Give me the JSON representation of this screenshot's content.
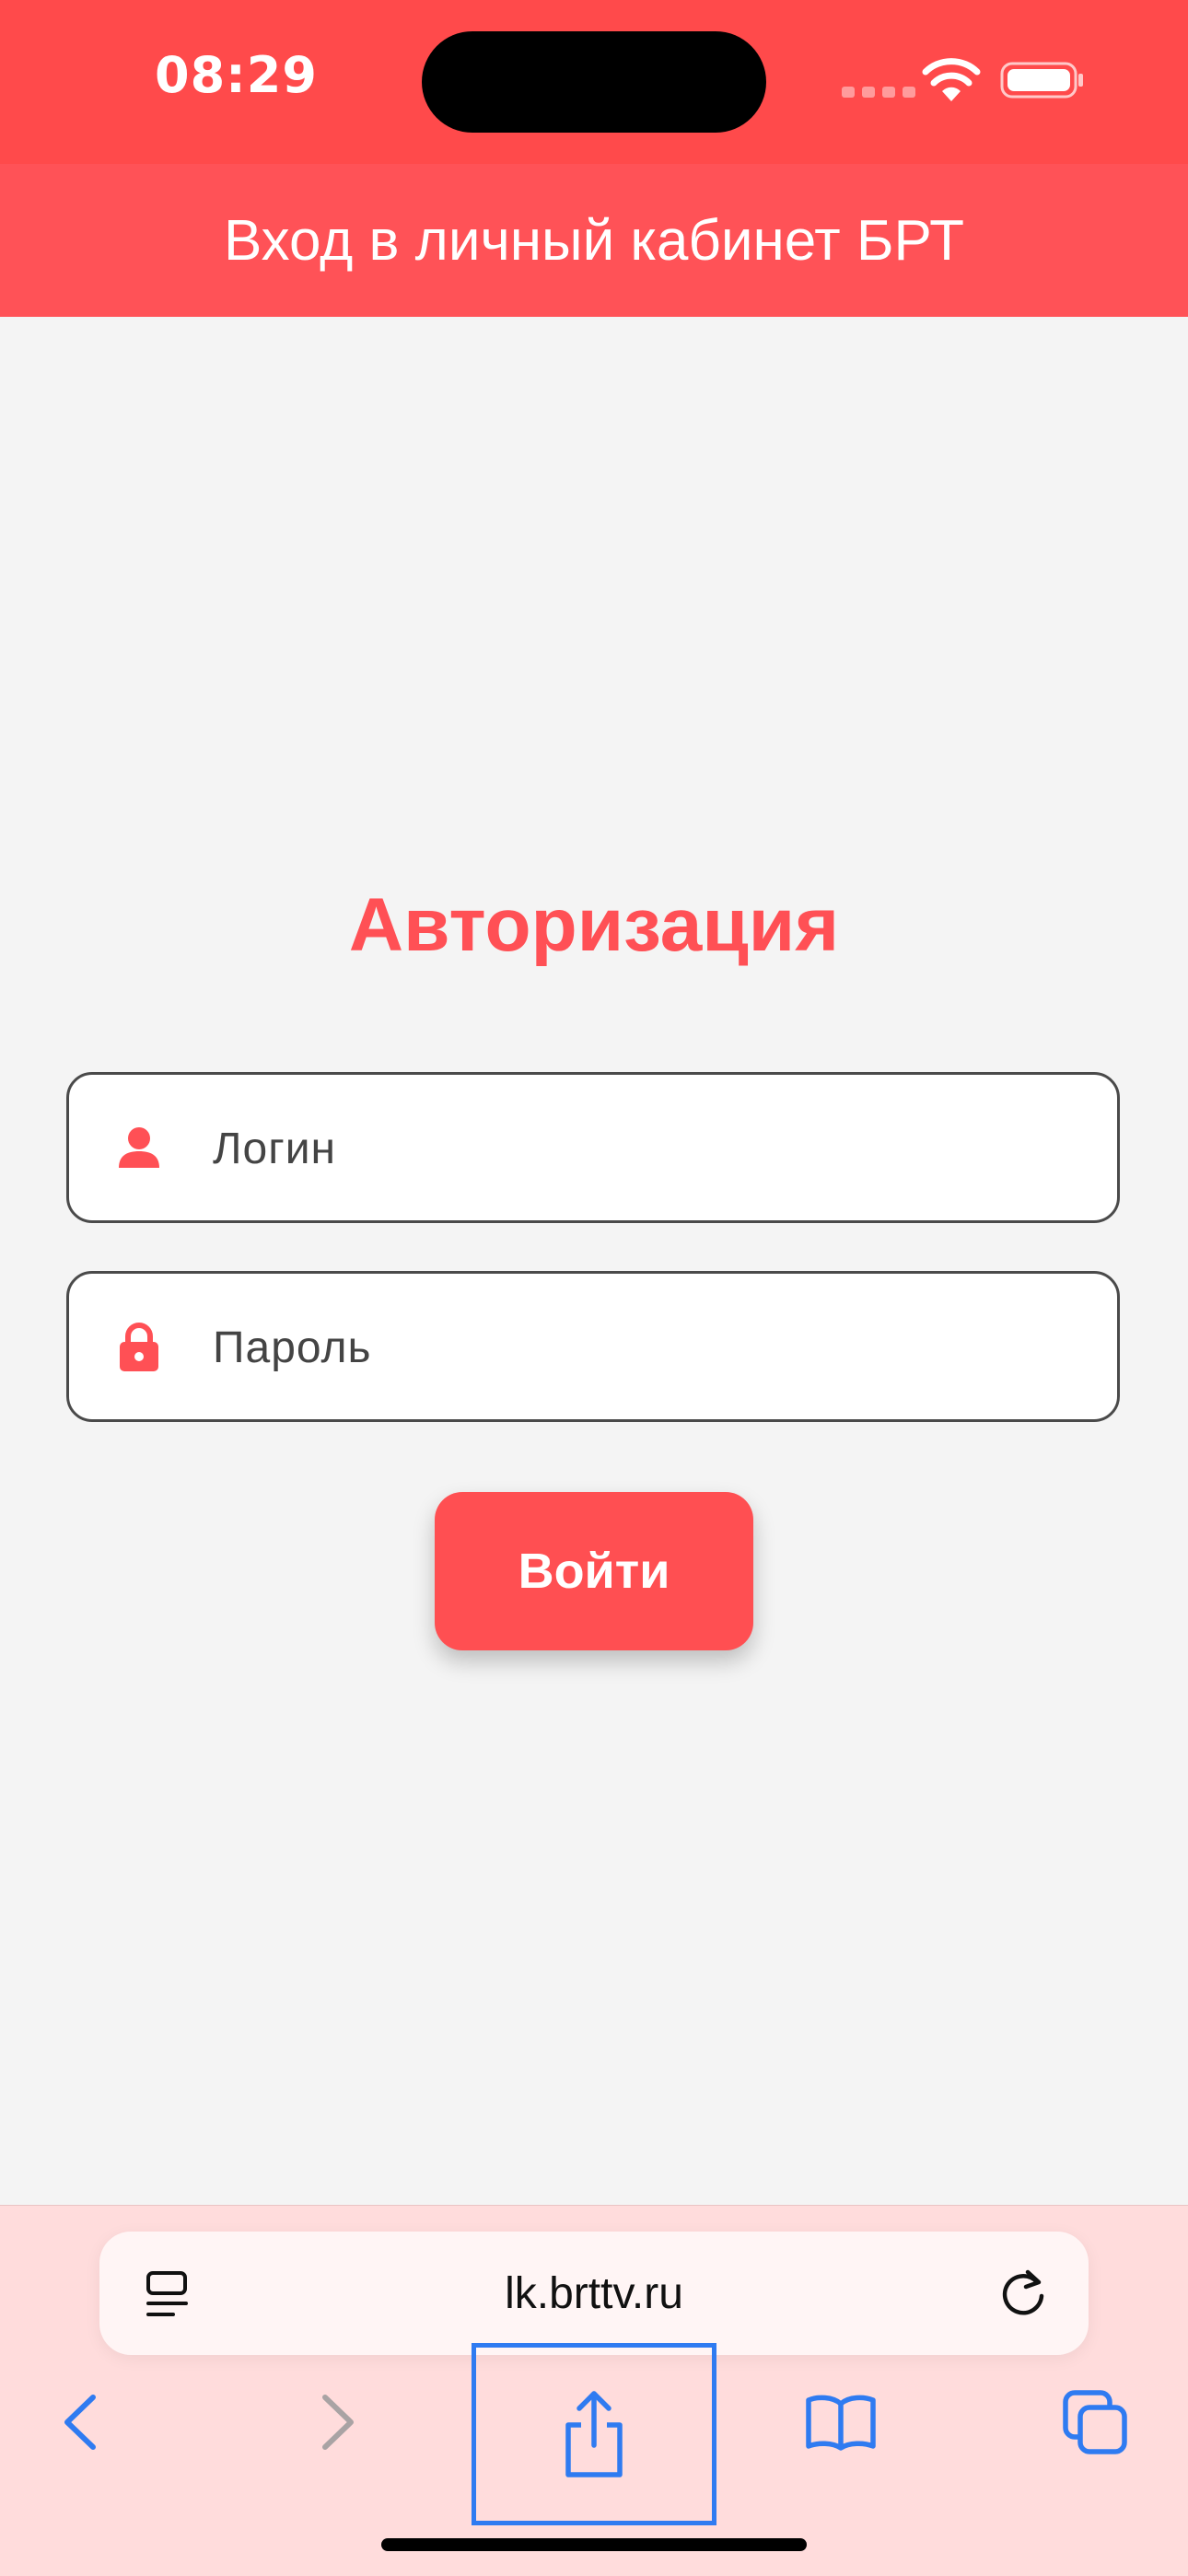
{
  "status_bar": {
    "time": "08:29",
    "icons": [
      "signal-dots-icon",
      "wifi-icon",
      "battery-icon"
    ]
  },
  "header": {
    "title": "Вход в личный кабинет БРТ"
  },
  "auth": {
    "title": "Авторизация",
    "login_placeholder": "Логин",
    "login_value": "",
    "password_placeholder": "Пароль",
    "password_value": "",
    "submit_label": "Войти"
  },
  "browser": {
    "url": "lk.brttv.ru",
    "toolbar": [
      "back",
      "forward",
      "share",
      "bookmarks",
      "tabs"
    ]
  },
  "colors": {
    "accent": "#ff4f52",
    "header_bg": "#ff5257",
    "status_bg": "#ff4a4b",
    "page_bg": "#f4f4f4",
    "toolbar_bg": "#ffdcdc",
    "safari_blue": "#2f7bf1"
  }
}
